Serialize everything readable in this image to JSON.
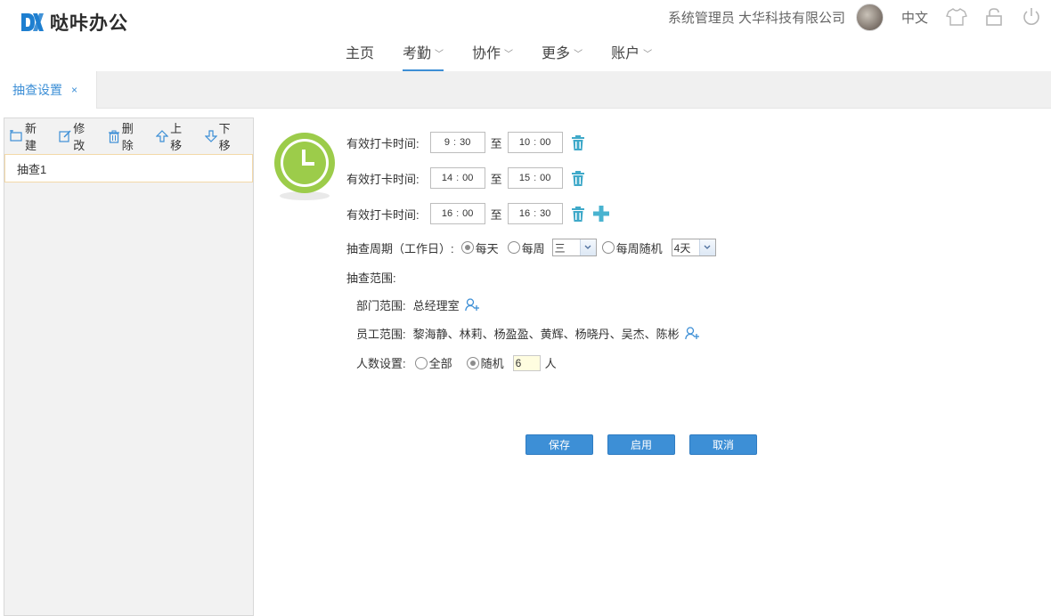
{
  "app": {
    "logo_text": "哒咔办公"
  },
  "header": {
    "user_name": "系统管理员 大华科技有限公司",
    "language": "中文",
    "icons": [
      "avatar",
      "shirt-icon",
      "lock-icon",
      "power-icon"
    ]
  },
  "nav": {
    "items": [
      {
        "label": "主页",
        "has_dropdown": false,
        "active": false
      },
      {
        "label": "考勤",
        "has_dropdown": true,
        "active": true
      },
      {
        "label": "协作",
        "has_dropdown": true,
        "active": false
      },
      {
        "label": "更多",
        "has_dropdown": true,
        "active": false
      },
      {
        "label": "账户",
        "has_dropdown": true,
        "active": false
      }
    ],
    "chevron": "﹀"
  },
  "tabs": [
    {
      "label": "抽查设置",
      "close": "×"
    }
  ],
  "sidebar": {
    "toolbar": {
      "new_label": "新建",
      "edit_label": "修改",
      "delete_label": "删除",
      "up_label": "上移",
      "down_label": "下移"
    },
    "items": [
      {
        "label": "抽查1"
      }
    ]
  },
  "form": {
    "time_label": "有效打卡时间:",
    "to_label": "至",
    "time_sep": ":",
    "times": [
      {
        "start_h": "9",
        "start_m": "30",
        "end_h": "10",
        "end_m": "00"
      },
      {
        "start_h": "14",
        "start_m": "00",
        "end_h": "15",
        "end_m": "00"
      },
      {
        "start_h": "16",
        "start_m": "00",
        "end_h": "16",
        "end_m": "30"
      }
    ],
    "period_label": "抽查周期（工作日）:",
    "period_options": {
      "daily": "每天",
      "weekly": "每周",
      "weekly_random": "每周随机"
    },
    "period_selected": "daily",
    "weekday_value": "三",
    "days_value": "4天",
    "scope_label": "抽查范围:",
    "dept_label": "部门范围:",
    "dept_value": "总经理室",
    "staff_label": "员工范围:",
    "staff_value": "黎海静、林莉、杨盈盈、黄辉、杨晓丹、吴杰、陈彬",
    "count_label": "人数设置:",
    "count_options": {
      "all": "全部",
      "random": "随机"
    },
    "count_selected": "random",
    "count_value": "6",
    "count_unit": "人"
  },
  "buttons": {
    "save": "保存",
    "enable": "启用",
    "cancel": "取消"
  },
  "colors": {
    "accent": "#3d8fd6",
    "clock_green": "#9ccc4a",
    "trash_teal": "#3fa9c9",
    "plus_teal": "#49b3d0"
  }
}
